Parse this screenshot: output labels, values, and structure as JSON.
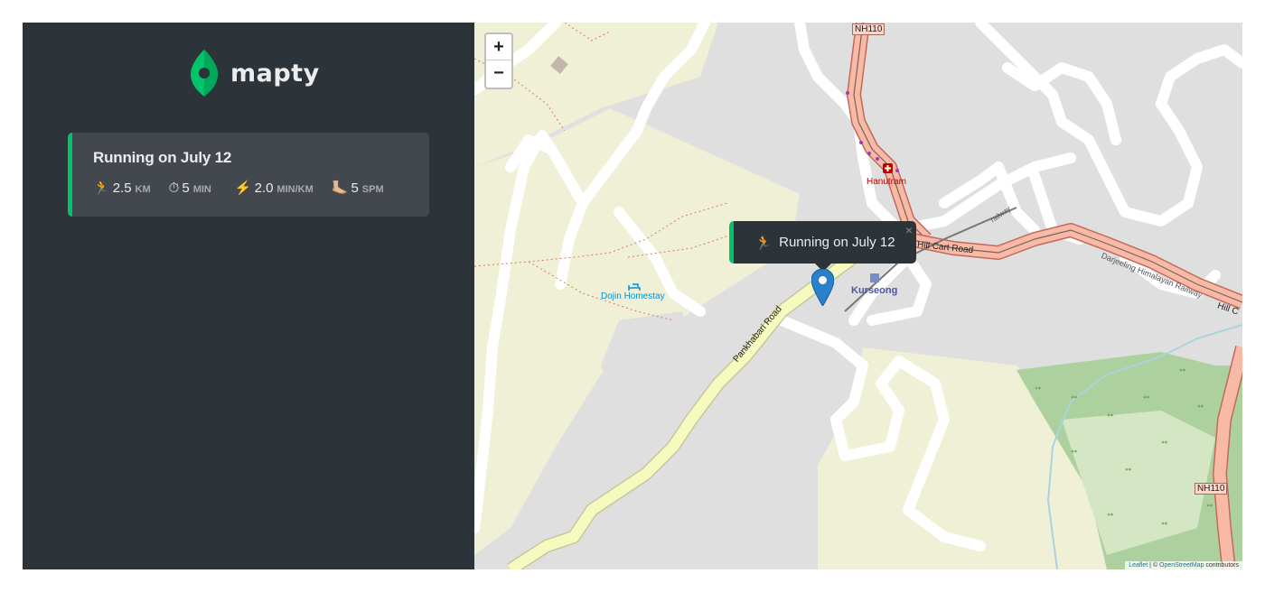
{
  "sidebar": {
    "logo_text": "mapty",
    "workouts": [
      {
        "title": "Running on July 12",
        "type_icon": "🏃",
        "distance": "2.5",
        "distance_unit": "km",
        "duration_icon": "⏱",
        "duration": "5",
        "duration_unit": "min",
        "pace_icon": "⚡️",
        "pace": "2.0",
        "pace_unit": "min/km",
        "cadence_icon": "🦶🏼",
        "cadence": "5",
        "cadence_unit": "spm"
      }
    ]
  },
  "map": {
    "zoom_in": "+",
    "zoom_out": "−",
    "popup": {
      "icon": "🏃",
      "text": "Running on July 12",
      "close": "×"
    },
    "labels": {
      "nh110_top": "NH110",
      "nh110_right": "NH110",
      "hanutram": "Hanutram",
      "hill_cart_road": "Hill Cart Road",
      "hill_cart_road_2": "Hill C",
      "darjeeling_railway": "Darjeeling Himalayan Railway",
      "railway": "railway",
      "kurseong": "Kurseong",
      "dojin_homestay": "Dojin Homestay",
      "pankhabari_road": "Pankhabari Road"
    },
    "attribution": {
      "leaflet": "Leaflet",
      "separator": " | © ",
      "osm": "OpenStreetMap",
      "contributors": " contributors"
    }
  },
  "colors": {
    "sidebar_bg": "#2d3439",
    "card_bg": "#42484d",
    "accent_green": "#00c46a",
    "text_light": "#ececec"
  }
}
